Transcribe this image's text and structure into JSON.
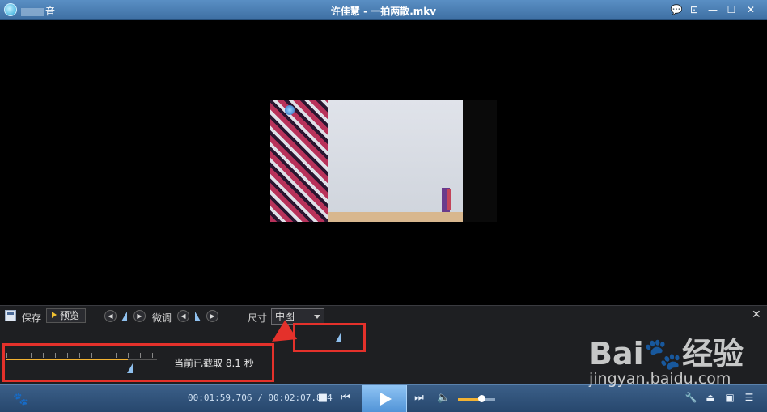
{
  "titlebar": {
    "app_name": "音",
    "title": "许佳慧 - 一拍两散.mkv",
    "buttons": [
      "💬",
      "⊡",
      "—",
      "☐",
      "✕"
    ]
  },
  "cut_toolbar": {
    "save_label": "保存",
    "preview_label": "预览",
    "finetune_label": "微调",
    "size_label": "尺寸",
    "size_value": "中图",
    "close_label": "✕"
  },
  "cut_info": {
    "text": "当前已截取 8.1 秒"
  },
  "player": {
    "time": "00:01:59.706 / 00:02:07.824",
    "volume_level": 0.6
  },
  "watermark": {
    "brand": "Bai🐾经验",
    "url": "jingyan.baidu.com"
  },
  "colors": {
    "accent": "#e4312b",
    "progress": "#f2b233",
    "controlbar": "#3b5f88"
  }
}
